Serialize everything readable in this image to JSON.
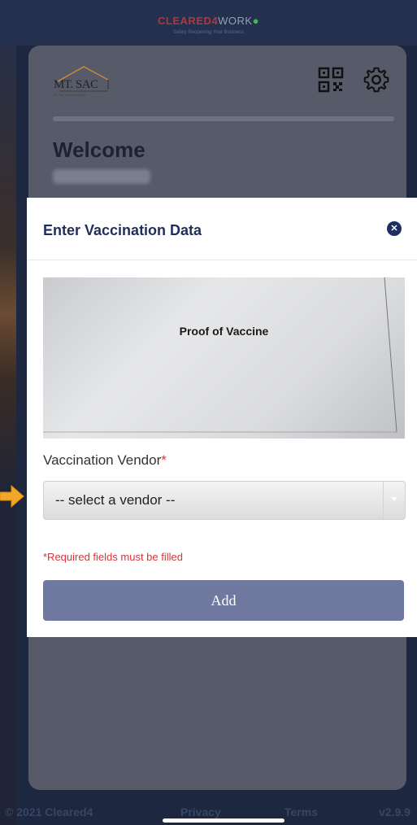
{
  "header": {
    "brand_part1": "CLEARED4",
    "brand_part2": "WORK",
    "brand_part3": "●",
    "brand_sub": "Safely Reopening Your Business"
  },
  "card": {
    "logo_text": "MT. SAC",
    "logo_subtext": "Mt. San Antonio College",
    "welcome": "Welcome",
    "icons": [
      "qr-code-icon",
      "gear-icon"
    ]
  },
  "modal": {
    "title": "Enter Vaccination Data",
    "close_symbol": "✕",
    "image_caption": "Proof of Vaccine",
    "vendor_label": "Vaccination Vendor",
    "required_mark": "*",
    "vendor_select_value": "-- select a vendor --",
    "error_message": "*Required fields must be filled",
    "add_label": "Add"
  },
  "footer": {
    "copyright": "© 2021 Cleared4",
    "privacy": "Privacy",
    "terms": "Terms",
    "version": "v2.9.9"
  },
  "colors": {
    "modal_title": "#1f2e5d",
    "button": "#6f789e",
    "error": "#d8343b",
    "annotation_arrow": "#f2a728"
  }
}
